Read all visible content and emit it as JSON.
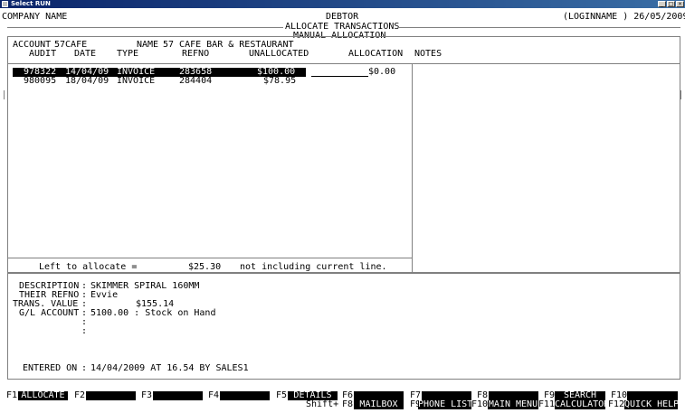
{
  "window": {
    "title": "Select RUN",
    "min": "_",
    "max": "□",
    "close": "×"
  },
  "header": {
    "company": "COMPANY NAME",
    "module": "DEBTOR",
    "screen": "ALLOCATE TRANSACTIONS",
    "subscreen": "MANUAL ALLOCATION",
    "user_date": "(LOGINNAME ) 26/05/2009"
  },
  "account": {
    "account_label": "ACCOUNT",
    "account_value": "57CAFE",
    "name_label": "NAME",
    "name_value": "57 CAFE BAR & RESTAURANT"
  },
  "columns": {
    "audit": "AUDIT",
    "date": "DATE",
    "type": "TYPE",
    "refno": "REFNO",
    "unallocated": "UNALLOCATED",
    "allocation": "ALLOCATION",
    "notes": "NOTES"
  },
  "rows": [
    {
      "audit": "978322",
      "date": "14/04/09",
      "type": "INVOICE",
      "refno": "283658",
      "unallocated": "$100.00",
      "allocation": "$0.00"
    },
    {
      "audit": "980095",
      "date": "18/04/09",
      "type": "INVOICE",
      "refno": "284404",
      "unallocated": "$78.95",
      "allocation": ""
    }
  ],
  "summary": {
    "left_label": "Left to allocate =",
    "left_value": "$25.30",
    "note": "not including current line."
  },
  "details": {
    "description_label": "DESCRIPTION",
    "description_value": "SKIMMER SPIRAL 160MM",
    "their_refno_label": "THEIR REFNO",
    "their_refno_value": "Evvie",
    "trans_value_label": "TRANS. VALUE",
    "trans_value_value": "$155.14",
    "gl_account_label": "G/L ACCOUNT",
    "gl_account_value": "5100.00 : Stock on Hand",
    "colon": ":",
    "entered_label": "ENTERED ON",
    "entered_value": "14/04/2009 AT 16.54 BY SALES1"
  },
  "fkeys": {
    "f1": "F1",
    "f1_label": "ALLOCATE",
    "f2": "F2",
    "f3": "F3",
    "f4": "F4",
    "f5": "F5",
    "f5_label": "DETAILS",
    "f6": "F6",
    "shift": "Shift+",
    "f8s": "F8",
    "f8s_label": "MAILBOX",
    "f7": "F7",
    "f9s": "F9",
    "f9s_label": "PHONE LIST",
    "f8": "F8",
    "f10s": "F10",
    "f10s_label": "MAIN MENU",
    "f9": "F9",
    "f9_label": "SEARCH",
    "f11s": "F11",
    "f11s_label": "CALCULATOR",
    "f10": "F10",
    "f12s": "F12",
    "f12s_label": "QUICK HELP"
  }
}
